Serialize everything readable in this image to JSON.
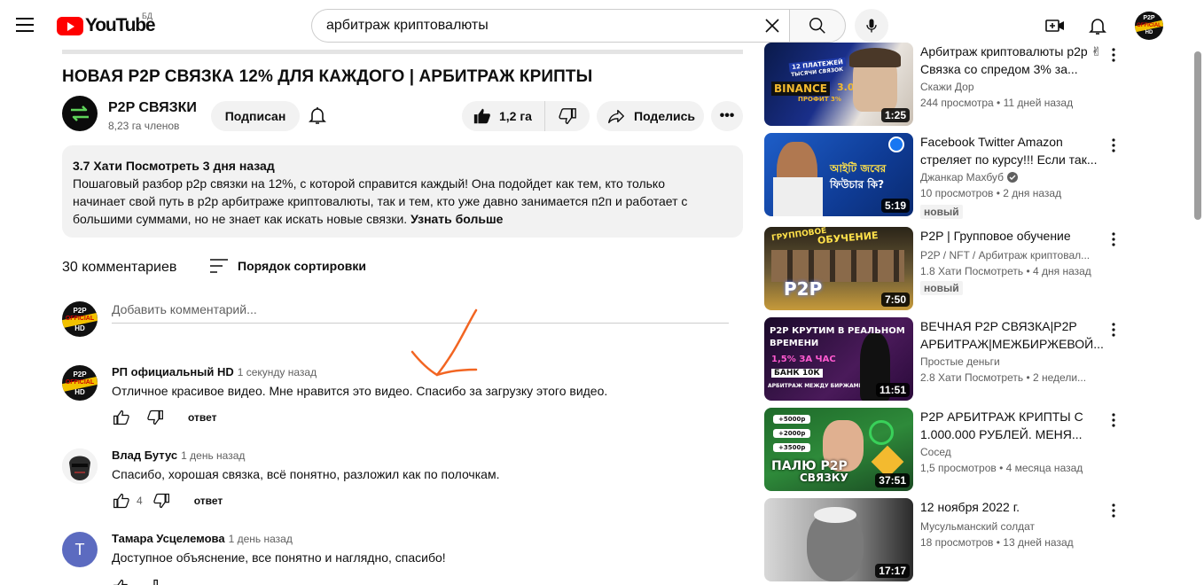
{
  "header": {
    "logo_text": "YouTube",
    "country_code": "БД",
    "search_value": "арбитраж криптовалюты"
  },
  "video": {
    "title": "НОВАЯ P2P СВЯЗКА 12% ДЛЯ КАЖДОГО | АРБИТРАЖ КРИПТЫ",
    "channel_name": "P2P СВЯЗКИ",
    "channel_subs": "8,23 га членов",
    "subscribe_label": "Подписан",
    "likes": "1,2 га",
    "share_label": "Поделись",
    "more_label": "•••"
  },
  "description": {
    "meta": "3.7 Хати Посмотреть 3 дня назад",
    "line1": "Пошаговый разбор p2p связки на 12%, с которой справится каждый! Она подойдет как тем, кто только",
    "line2": "начинает свой путь в p2p арбитраже криптовалюты, так и тем, кто уже давно занимается п2п и работает с",
    "line3": "большими суммами, но не знает как искать новые связки.",
    "more": "Узнать больше"
  },
  "comments_header": {
    "count": "30 комментариев",
    "sort_label": "Порядок сортировки",
    "add_placeholder": "Добавить комментарий..."
  },
  "comments": [
    {
      "author": "РП официальный HD",
      "time": "1 секунду назад",
      "text": "Отличное красивое видео. Мне нравится это видео. Спасибо за загрузку этого видео.",
      "likes": "",
      "reply": "ответ"
    },
    {
      "author": "Влад Бутус",
      "time": "1 день назад",
      "text": "Спасибо, хорошая связка, всё понятно, разложил как по полочкам.",
      "likes": "4",
      "reply": "ответ"
    },
    {
      "author": "Тамара Усцелемова",
      "time": "1 день назад",
      "text": "Доступное объяснение, все понятно и наглядно, спасибо!",
      "avatar_letter": "T",
      "avatar_color": "#5c6bc0"
    }
  ],
  "avatar_art": {
    "line1": "P2P",
    "line2": "OFFICIAL",
    "line3": "HD"
  },
  "sidebar": [
    {
      "title": "Арбитраж криптовалюты p2p ✌ Связка со спредом 3% за...",
      "channel": "Скажи Дор",
      "views": "244 просмотра",
      "age": "11 дней назад",
      "duration": "1:25",
      "thumb_text": [
        "12 ПЛАТЕЖЕЙ",
        "ТЫСЯЧИ СВЯЗОК",
        "BINANCE",
        "3.0",
        "ПРОФИТ 3%"
      ]
    },
    {
      "title": "Facebook Twitter Amazon стреляет по курсу!!! Если так...",
      "channel": "Джанкар Махбуб",
      "views": "10 просмотров",
      "age": "2 дня назад",
      "duration": "5:19",
      "badge": "новый",
      "thumb_text": [
        "আইটি জবের",
        "ফিউচার কি?"
      ]
    },
    {
      "title": "P2P | Групповое обучение",
      "channel": "P2P / NFT / Арбитраж криптовал...",
      "views": "1.8 Хати Посмотреть",
      "age": "4 дня назад",
      "duration": "7:50",
      "badge": "новый",
      "thumb_text": [
        "ГРУППОВОЕ",
        "ОБУЧЕНИЕ",
        "P2P"
      ]
    },
    {
      "title": "ВЕЧНАЯ P2P СВЯЗКА|P2P АРБИТРАЖ|МЕЖБИРЖЕВОЙ...",
      "channel": "Простые деньги",
      "views": "2.8 Хати Посмотреть",
      "age": "2 недели...",
      "duration": "11:51",
      "thumb_text": [
        "P2P КРУТИМ В РЕАЛЬНОМ",
        "ВРЕМЕНИ",
        "1,5% ЗА ЧАС",
        "БАНК 10К",
        "АРБИТРАЖ МЕЖДУ БИРЖАМИ"
      ]
    },
    {
      "title": "P2P АРБИТРАЖ КРИПТЫ С 1.000.000 РУБЛЕЙ. МЕНЯ...",
      "channel": "Сосед",
      "views": "1,5 просмотров",
      "age": "4 месяца назад",
      "duration": "37:51",
      "thumb_text": [
        "+5000р",
        "+2000р",
        "+3500р",
        "ПАЛЮ P2P",
        "СВЯЗКУ"
      ]
    },
    {
      "title": "12 ноября 2022 г.",
      "channel": "Мусульманский солдат",
      "views": "18 просмотров",
      "age": "13 дней назад",
      "duration": "17:17",
      "thumb_text": []
    }
  ],
  "colors": {
    "brand_red": "#ff0000",
    "annotation_orange": "#f26522",
    "avatar_yellow": "#f2c200"
  }
}
